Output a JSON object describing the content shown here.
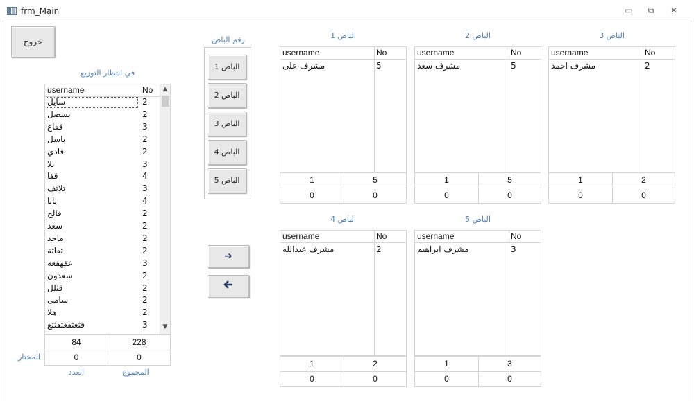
{
  "window": {
    "title": "frm_Main",
    "minimize": "▭",
    "restore": "⧉",
    "close": "✕"
  },
  "exit_button": "خروج",
  "bus_number_caption": "رقم الباص",
  "bus_buttons": [
    "الباص 1",
    "الباص 2",
    "الباص 3",
    "الباص 4",
    "الباص 5"
  ],
  "arrows": {
    "right": "➔",
    "left": "🡐"
  },
  "waiting": {
    "caption": "في انتظار التوزيع",
    "col_username": "username",
    "col_no": "No",
    "rows": [
      {
        "name": "سايل",
        "no": "2"
      },
      {
        "name": "يسصل",
        "no": "2"
      },
      {
        "name": "قفاغ",
        "no": "3"
      },
      {
        "name": "باسل",
        "no": "2"
      },
      {
        "name": "فادي",
        "no": "2"
      },
      {
        "name": "بلا",
        "no": "3"
      },
      {
        "name": "قفا",
        "no": "4"
      },
      {
        "name": "تلاتف",
        "no": "3"
      },
      {
        "name": "بابا",
        "no": "4"
      },
      {
        "name": "فالح",
        "no": "2"
      },
      {
        "name": "سعد",
        "no": "2"
      },
      {
        "name": "ماجد",
        "no": "2"
      },
      {
        "name": "ثقاثة",
        "no": "2"
      },
      {
        "name": "عفهفعه",
        "no": "3"
      },
      {
        "name": "سعدون",
        "no": "2"
      },
      {
        "name": "قثلل",
        "no": "2"
      },
      {
        "name": "سامى",
        "no": "2"
      },
      {
        "name": "هلا",
        "no": "2"
      },
      {
        "name": "فثغثفغثفثثغ",
        "no": "3"
      }
    ],
    "total_count": "84",
    "total_sum": "228",
    "selected_count": "0",
    "selected_sum": "0",
    "selected_label": "المختار",
    "count_label": "العدد",
    "sum_label": "المجموع"
  },
  "buses": [
    {
      "caption": "الباص 1",
      "col_username": "username",
      "col_no": "No",
      "rows": [
        {
          "name": "مشرف على",
          "no": "5"
        }
      ],
      "f1": "1",
      "f2": "5",
      "f3": "0",
      "f4": "0"
    },
    {
      "caption": "الباص 2",
      "col_username": "username",
      "col_no": "No",
      "rows": [
        {
          "name": "مشرف سعد",
          "no": "5"
        }
      ],
      "f1": "1",
      "f2": "5",
      "f3": "0",
      "f4": "0"
    },
    {
      "caption": "الباص 3",
      "col_username": "username",
      "col_no": "No",
      "rows": [
        {
          "name": "مشرف احمد",
          "no": "2"
        }
      ],
      "f1": "1",
      "f2": "2",
      "f3": "0",
      "f4": "0"
    },
    {
      "caption": "الباص 4",
      "col_username": "username",
      "col_no": "No",
      "rows": [
        {
          "name": "مشرف عبدالله",
          "no": "2"
        }
      ],
      "f1": "1",
      "f2": "2",
      "f3": "0",
      "f4": "0"
    },
    {
      "caption": "الباص 5",
      "col_username": "username",
      "col_no": "No",
      "rows": [
        {
          "name": "مشرف ابراهيم",
          "no": "3"
        }
      ],
      "f1": "1",
      "f2": "3",
      "f3": "0",
      "f4": "0"
    }
  ]
}
